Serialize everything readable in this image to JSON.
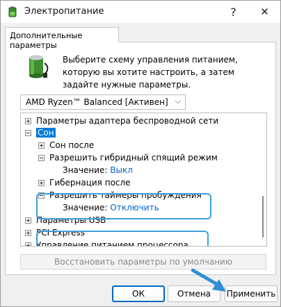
{
  "window": {
    "title": "Электропитание",
    "help_glyph": "?",
    "close_glyph": "✕"
  },
  "tab": {
    "label": "Дополнительные параметры"
  },
  "description": "Выберите схему управления питанием, которую вы хотите настроить, а затем задайте нужные параметры.",
  "scheme_dropdown": {
    "selected": "AMD Ryzen™ Balanced [Активен]",
    "chevron": "⌵"
  },
  "tree": {
    "items": [
      {
        "label": "Параметры адаптера беспроводной сети",
        "expander": "+",
        "level": 0
      },
      {
        "label": "Сон",
        "expander": "−",
        "level": 0,
        "selected": true
      },
      {
        "label": "Сон после",
        "expander": "+",
        "level": 1
      },
      {
        "label": "Разрешить гибридный спящий режим",
        "expander": "−",
        "level": 1
      },
      {
        "label": "Значение:",
        "value": "Выкл",
        "level": 2
      },
      {
        "label": "Гибернация после",
        "expander": "+",
        "level": 1
      },
      {
        "label": "Разрешить таймеры пробуждения",
        "expander": "−",
        "level": 1
      },
      {
        "label": "Значение:",
        "value": "Отключить",
        "level": 2
      },
      {
        "label": "Параметры USB",
        "expander": "+",
        "level": 0
      },
      {
        "label": "PCI Express",
        "expander": "+",
        "level": 0
      },
      {
        "label": "Управление питанием процессора",
        "expander": "+",
        "level": 0
      }
    ]
  },
  "buttons": {
    "restore": "Восстановить параметры по умолчанию",
    "ok": "ОК",
    "cancel": "Отмена",
    "apply": "Применить"
  },
  "colors": {
    "accent": "#0078d7",
    "highlight_outline": "#3aa0d8",
    "link": "#0066cc",
    "arrow": "#2f8fd6"
  }
}
